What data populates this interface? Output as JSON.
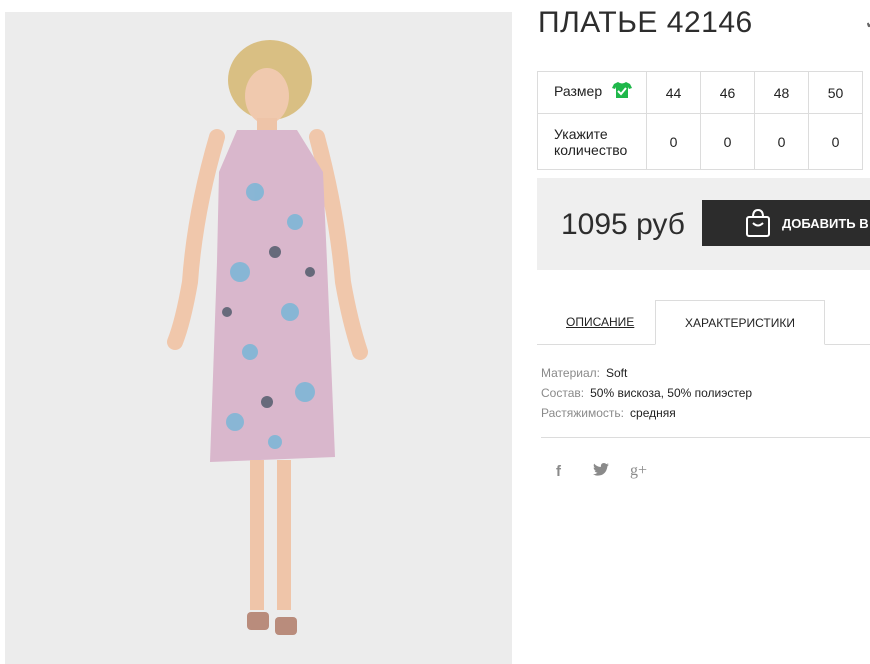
{
  "product": {
    "title": "ПЛАТЬЕ 42146",
    "title_trailing": "✓"
  },
  "sizes": {
    "size_label": "Размер",
    "size_icon": "shirt-check-icon",
    "values": [
      "44",
      "46",
      "48",
      "50"
    ],
    "qty_label_line1": "Укажите",
    "qty_label_line2": "количество",
    "quantities": [
      "0",
      "0",
      "0",
      "0"
    ]
  },
  "purchase": {
    "price": "1095 руб",
    "button_label": "ДОБАВИТЬ В З"
  },
  "tabs": {
    "description": "ОПИСАНИЕ",
    "characteristics": "ХАРАКТЕРИСТИКИ"
  },
  "specs": [
    {
      "key": "Материал:",
      "value": "Soft"
    },
    {
      "key": "Состав:",
      "value": "50% вискоза, 50% полиэстер"
    },
    {
      "key": "Растяжимость:",
      "value": "средняя"
    }
  ],
  "social": {
    "facebook": "f",
    "twitter": "🐦",
    "googleplus": "g+"
  },
  "colors": {
    "accent_green": "#1fb74a",
    "button_dark": "#2c2c2c",
    "price_bg": "#efefef"
  }
}
